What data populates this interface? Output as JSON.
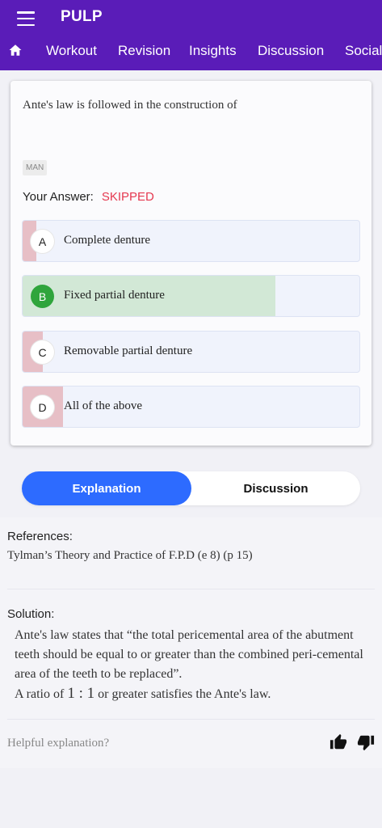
{
  "app": {
    "title": "PULP"
  },
  "nav": {
    "items": [
      {
        "label": "Workout"
      },
      {
        "label": "Revision"
      },
      {
        "label": "Insights"
      },
      {
        "label": "Discussion"
      },
      {
        "label": "Social"
      }
    ]
  },
  "question": {
    "text": "Ante's law is followed in the construction of",
    "tag": "MAN",
    "answer_label": "Your Answer:",
    "answer_status": "SKIPPED",
    "options": [
      {
        "letter": "A",
        "text": "Complete denture",
        "fill": 0.04,
        "correct": false
      },
      {
        "letter": "B",
        "text": "Fixed partial denture",
        "fill": 0.75,
        "correct": true
      },
      {
        "letter": "C",
        "text": "Removable partial denture",
        "fill": 0.06,
        "correct": false
      },
      {
        "letter": "D",
        "text": "All of the above",
        "fill": 0.12,
        "correct": false
      }
    ]
  },
  "tabs": {
    "explanation": "Explanation",
    "discussion": "Discussion"
  },
  "explanation": {
    "references_label": "References:",
    "reference": "Tylman’s Theory and Practice of F.P.D (e 8) (p 15)",
    "solution_label": "Solution:",
    "solution_line1": "Ante's law states that “the total pericemental area of the abutment teeth should be equal to or greater than the combined peri-cemental area of the teeth to be replaced”.",
    "ratio_prefix": "A ratio of",
    "ratio_value": "1 : 1",
    "ratio_suffix": "or greater satisfies the Ante's law.",
    "helpful_label": "Helpful explanation?"
  },
  "colors": {
    "appbar": "#5a1cb8",
    "accent": "#2d6bff",
    "skipped": "#e53950",
    "correct": "#2fa53c",
    "wrong_fill": "#e7bfc6",
    "correct_fill": "#d2e8d6"
  },
  "icons": [
    "menu-icon",
    "home-icon",
    "thumbs-up-icon",
    "thumbs-down-icon"
  ]
}
